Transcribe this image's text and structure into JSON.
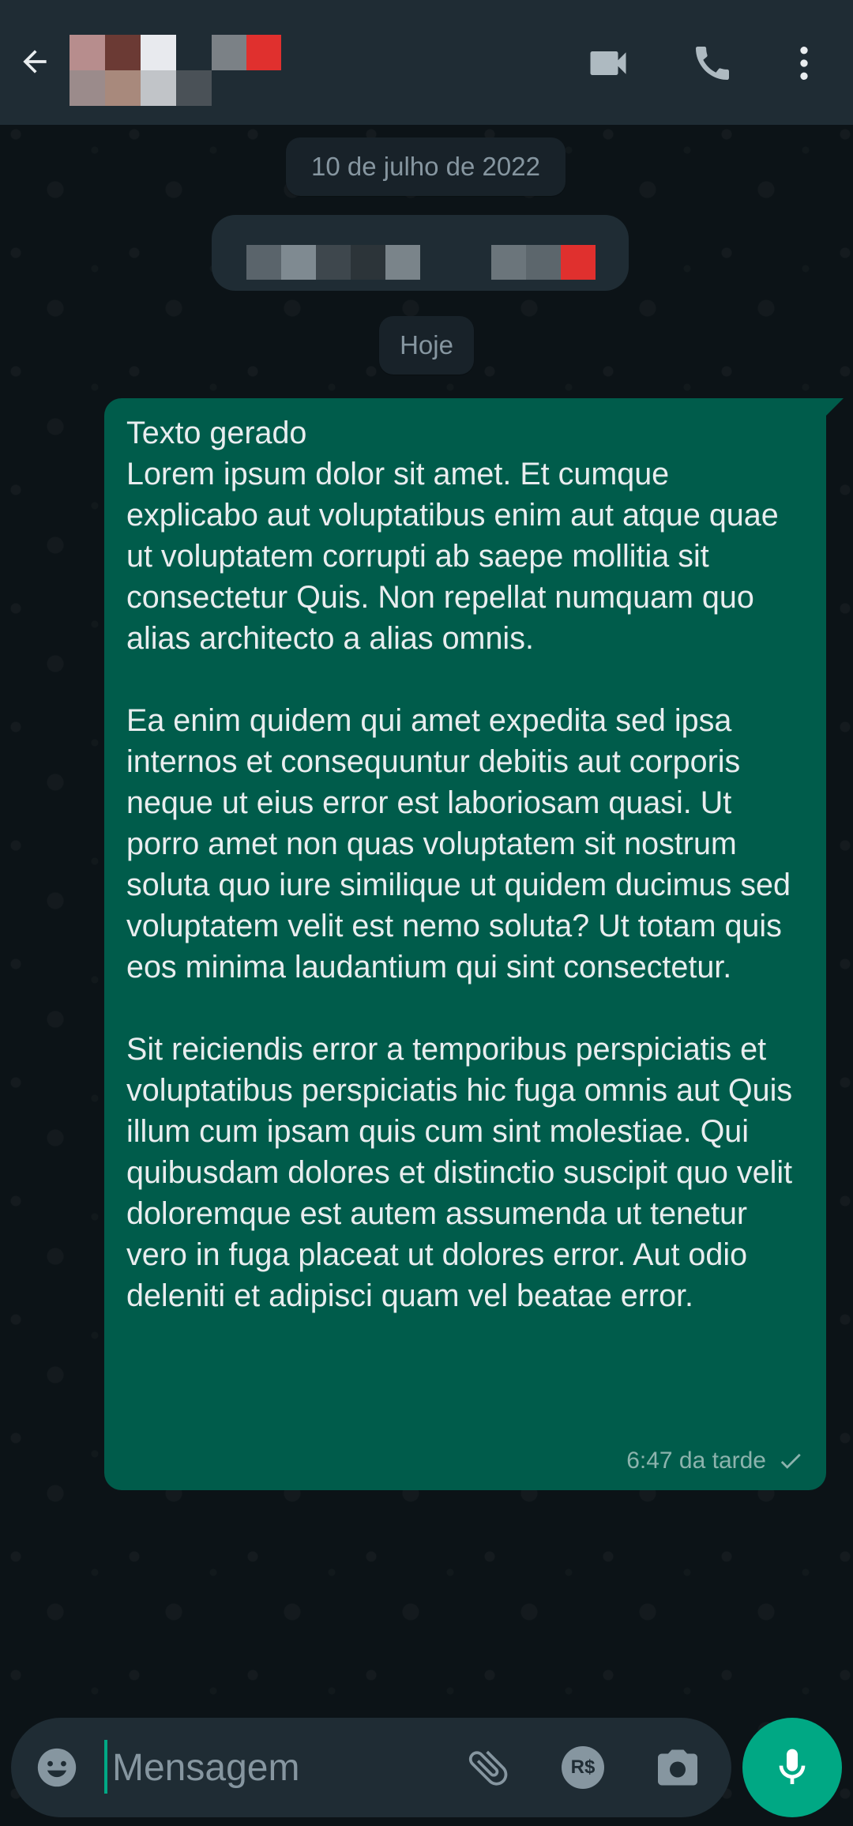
{
  "colors": {
    "header_bg": "#1f2c34",
    "chat_bg": "#0b141a",
    "outgoing_bubble": "#005c4b",
    "accent": "#00a884",
    "icon": "#aebac1"
  },
  "header": {
    "icons": [
      "back-arrow-icon",
      "video-call-icon",
      "voice-call-icon",
      "more-options-icon"
    ]
  },
  "chat": {
    "date_chip": "10 de julho de 2022",
    "today_chip": "Hoje",
    "message": {
      "text": "Texto gerado\nLorem ipsum dolor sit amet. Et cumque explicabo aut voluptatibus enim aut atque quae ut voluptatem corrupti ab saepe mollitia sit consectetur Quis. Non repellat numquam quo alias architecto a alias omnis.\n\nEa enim quidem qui amet expedita sed ipsa internos et consequuntur debitis aut corporis neque ut eius error est laboriosam quasi. Ut porro amet non quas voluptatem sit nostrum soluta quo iure similique ut quidem ducimus sed voluptatem velit est nemo soluta? Ut totam quis eos minima laudantium qui sint consectetur.\n\nSit reiciendis error a temporibus perspiciatis et voluptatibus perspiciatis hic fuga omnis aut Quis illum cum ipsam quis cum sint molestiae. Qui quibusdam dolores et distinctio suscipit quo velit doloremque est autem assumenda ut tenetur vero in fuga placeat ut dolores error. Aut odio deleniti et adipisci quam vel beatae error.",
      "time": "6:47 da tarde",
      "status_icon": "single-check-icon"
    }
  },
  "composer": {
    "placeholder": "Mensagem",
    "icons": [
      "emoji-icon",
      "attach-icon",
      "payment-icon",
      "camera-icon",
      "mic-icon"
    ],
    "payment_label": "R$"
  }
}
